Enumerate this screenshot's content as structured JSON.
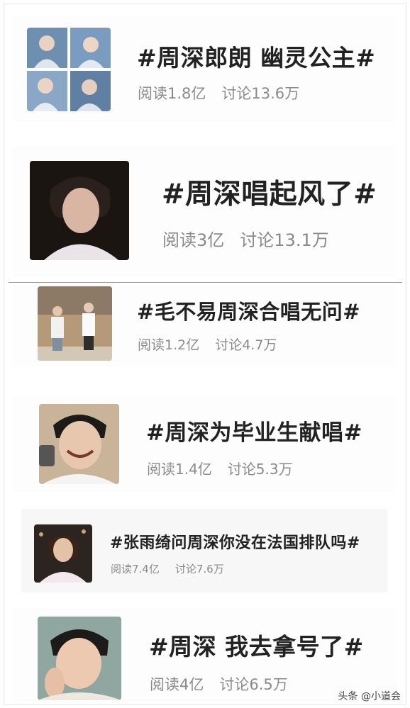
{
  "topics": [
    {
      "title": "#周深郎朗 幽灵公主#",
      "read": "阅读1.8亿",
      "discuss": "讨论13.6万",
      "thumb_icon": "photo-collage-icon"
    },
    {
      "title": "#周深唱起风了#",
      "read": "阅读3亿",
      "discuss": "讨论13.1万",
      "thumb_icon": "portrait-photo-icon"
    },
    {
      "title": "#毛不易周深合唱无问#",
      "read": "阅读1.2亿",
      "discuss": "讨论4.7万",
      "thumb_icon": "stage-photo-icon"
    },
    {
      "title": "#周深为毕业生献唱#",
      "read": "阅读1.4亿",
      "discuss": "讨论5.3万",
      "thumb_icon": "smiling-photo-icon"
    },
    {
      "title": "#张雨绮问周深你没在法国排队吗#",
      "read": "阅读7.4亿",
      "discuss": "讨论7.6万",
      "thumb_icon": "woman-photo-icon"
    },
    {
      "title": "#周深 我去拿号了#",
      "read": "阅读4亿",
      "discuss": "讨论6.5万",
      "thumb_icon": "face-photo-icon"
    }
  ],
  "watermark": "头条 @小道会",
  "colors": {
    "title": "#222222",
    "stats": "#8a8a8a",
    "divider": "#9a9a9a",
    "card_bg_alt": "#f7f7f7"
  }
}
